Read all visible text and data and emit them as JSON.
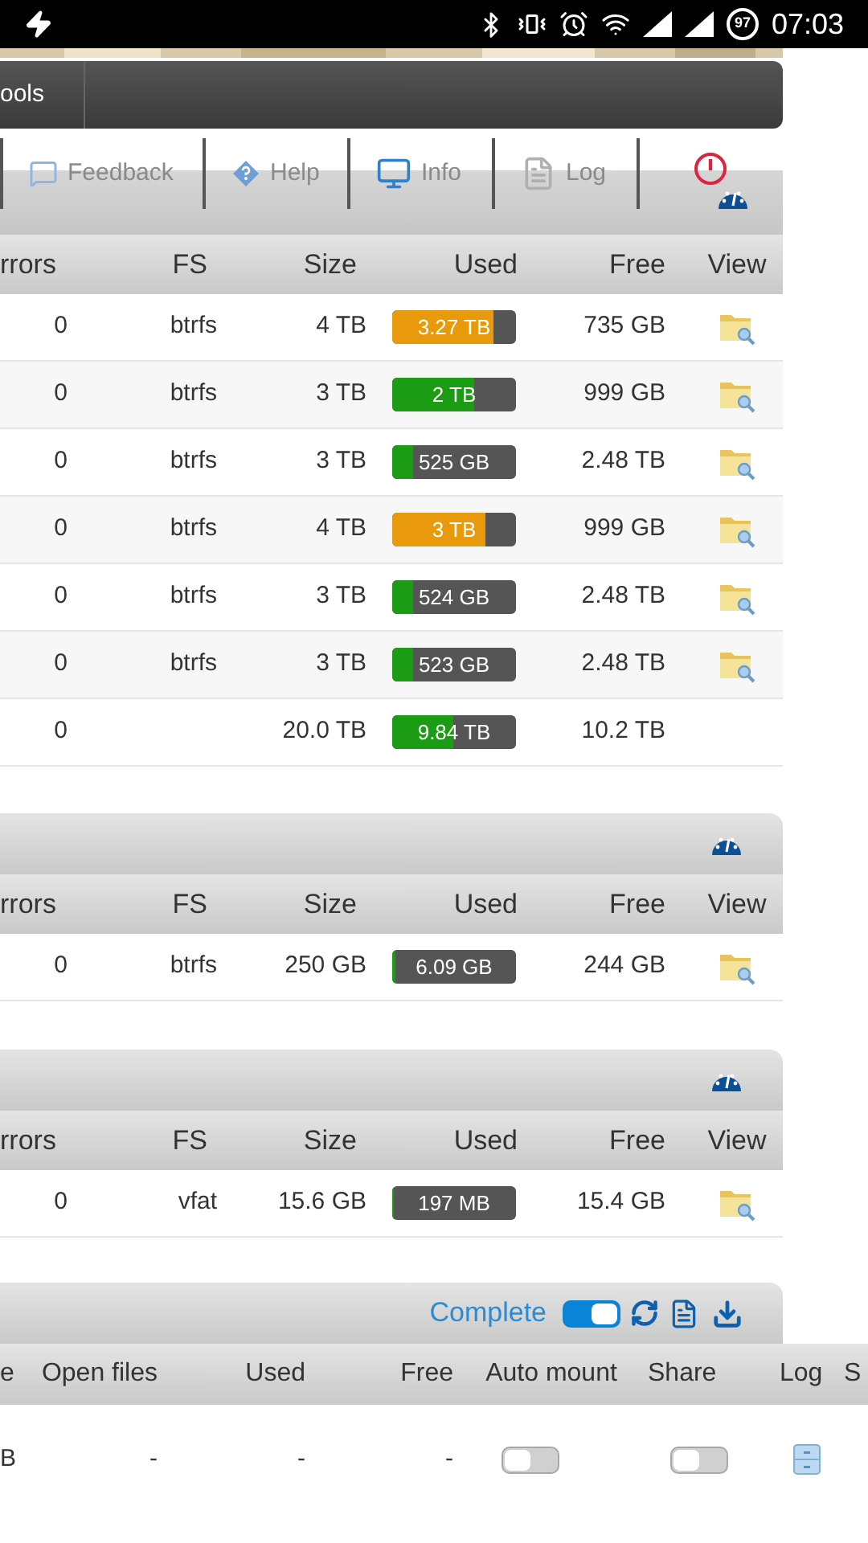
{
  "status_bar": {
    "battery": "97",
    "time": "07:03"
  },
  "nav": {
    "label": "ools"
  },
  "toolbar": [
    {
      "kind": "feedback",
      "label": "Feedback"
    },
    {
      "kind": "help",
      "label": "Help"
    },
    {
      "kind": "info",
      "label": "Info"
    },
    {
      "kind": "log",
      "label": "Log"
    },
    {
      "kind": "power"
    }
  ],
  "tables": [
    {
      "columns": [
        "rrors",
        "FS",
        "Size",
        "Used",
        "Free",
        "View"
      ],
      "rows": [
        {
          "errors": "0",
          "fs": "btrfs",
          "size": "4 TB",
          "used": "3.27 TB",
          "level": 0.82,
          "color": "#e89a0c",
          "free": "735 GB",
          "view": true
        },
        {
          "errors": "0",
          "fs": "btrfs",
          "size": "3 TB",
          "used": "2 TB",
          "level": 0.66,
          "color": "#1b9c14",
          "free": "999 GB",
          "view": true
        },
        {
          "errors": "0",
          "fs": "btrfs",
          "size": "3 TB",
          "used": "525 GB",
          "level": 0.17,
          "color": "#1b9c14",
          "free": "2.48 TB",
          "view": true
        },
        {
          "errors": "0",
          "fs": "btrfs",
          "size": "4 TB",
          "used": "3 TB",
          "level": 0.75,
          "color": "#e89a0c",
          "free": "999 GB",
          "view": true
        },
        {
          "errors": "0",
          "fs": "btrfs",
          "size": "3 TB",
          "used": "524 GB",
          "level": 0.17,
          "color": "#1b9c14",
          "free": "2.48 TB",
          "view": true
        },
        {
          "errors": "0",
          "fs": "btrfs",
          "size": "3 TB",
          "used": "523 GB",
          "level": 0.17,
          "color": "#1b9c14",
          "free": "2.48 TB",
          "view": true
        },
        {
          "errors": "0",
          "size": "20.0 TB",
          "used": "9.84 TB",
          "level": 0.49,
          "color": "#1b9c14",
          "free": "10.2 TB",
          "view": false
        }
      ]
    },
    {
      "columns": [
        "rrors",
        "FS",
        "Size",
        "Used",
        "Free",
        "View"
      ],
      "rows": [
        {
          "errors": "0",
          "fs": "btrfs",
          "size": "250 GB",
          "used": "6.09 GB",
          "level": 0.02,
          "color": "#1b9c14",
          "free": "244 GB",
          "view": true
        }
      ]
    },
    {
      "columns": [
        "rrors",
        "FS",
        "Size",
        "Used",
        "Free",
        "View"
      ],
      "rows": [
        {
          "errors": "0",
          "fs": "vfat",
          "size": "15.6 GB",
          "used": "197 MB",
          "level": 0.01,
          "color": "#1b9c14",
          "free": "15.4 GB",
          "view": true
        }
      ]
    }
  ],
  "shares": {
    "complete_label": "Complete",
    "complete_on": true,
    "columns": [
      "e",
      "Open files",
      "Used",
      "Free",
      "Auto mount",
      "Share",
      "Log",
      "S"
    ],
    "rows": [
      {
        "cells": [
          "B",
          "-",
          "-",
          "-"
        ],
        "auto_mount": false,
        "share": false
      }
    ]
  }
}
